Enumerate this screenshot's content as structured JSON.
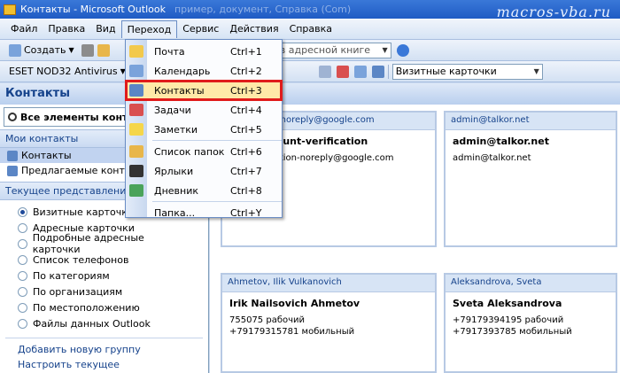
{
  "window": {
    "title": "Контакты - Microsoft Outlook",
    "title_faded": "пример, документ, Справка (Com)",
    "watermark": "macros-vba.ru"
  },
  "menubar": [
    "Файл",
    "Правка",
    "Вид",
    "Переход",
    "Сервис",
    "Действия",
    "Справка"
  ],
  "toolbar": {
    "create": "Создать",
    "search_placeholder": "к в адресной книге",
    "eset": "ESET NOD32 Antivirus",
    "view_select": "Визитные карточки"
  },
  "menu": {
    "items": [
      {
        "label": "Почта",
        "key": "Ctrl+1",
        "icon": "mail-icon",
        "color": "#f2c94c"
      },
      {
        "label": "Календарь",
        "key": "Ctrl+2",
        "icon": "calendar-icon",
        "color": "#7aa3db"
      },
      {
        "label": "Контакты",
        "key": "Ctrl+3",
        "icon": "contacts-icon",
        "color": "#5b86c5",
        "highlighted": true
      },
      {
        "label": "Задачи",
        "key": "Ctrl+4",
        "icon": "tasks-icon",
        "color": "#d94f4f"
      },
      {
        "label": "Заметки",
        "key": "Ctrl+5",
        "icon": "notes-icon",
        "color": "#f5d64a"
      },
      {
        "label": "Список папок",
        "key": "Ctrl+6",
        "icon": "folder-list-icon",
        "color": "#e8b64a"
      },
      {
        "label": "Ярлыки",
        "key": "Ctrl+7",
        "icon": "shortcut-icon",
        "color": "#333333"
      },
      {
        "label": "Дневник",
        "key": "Ctrl+8",
        "icon": "journal-icon",
        "color": "#4aa35a"
      },
      {
        "label": "Папка...",
        "key": "Ctrl+Y",
        "icon": "",
        "color": ""
      }
    ]
  },
  "left": {
    "title": "Контакты",
    "all_items": "Все элементы контакт",
    "my_contacts_header": "Мои контакты",
    "my_contacts": [
      "Контакты",
      "Предлагаемые контак"
    ],
    "current_view_header": "Текущее представление",
    "views": [
      "Визитные карточки",
      "Адресные карточки",
      "Подробные адресные карточки",
      "Список телефонов",
      "По категориям",
      "По организациям",
      "По местоположению",
      "Файлы данных Outlook"
    ],
    "selected_view": 0,
    "link_add_group": "Добавить новую группу",
    "link_customize": "Настроить текущее представление..."
  },
  "right": {
    "title": "Контакты",
    "cards": [
      {
        "head": "verification-noreply@google.com",
        "name": "ount account-verification",
        "lines": [
          "unt-verification-noreply@google.com"
        ]
      },
      {
        "head": "admin@talkor.net",
        "name": "admin@talkor.net",
        "lines": [
          "admin@talkor.net"
        ]
      },
      {
        "head": "Ahmetov, Ilik Vulkanovich",
        "name": "Irik Nailsovich Ahmetov",
        "lines": [
          "755075 рабочий",
          "+79179315781 мобильный"
        ]
      },
      {
        "head": "Aleksandrova, Sveta",
        "name": "Sveta Aleksandrova",
        "lines": [
          "+79179394195 рабочий",
          "+7917393785 мобильный"
        ]
      }
    ]
  }
}
